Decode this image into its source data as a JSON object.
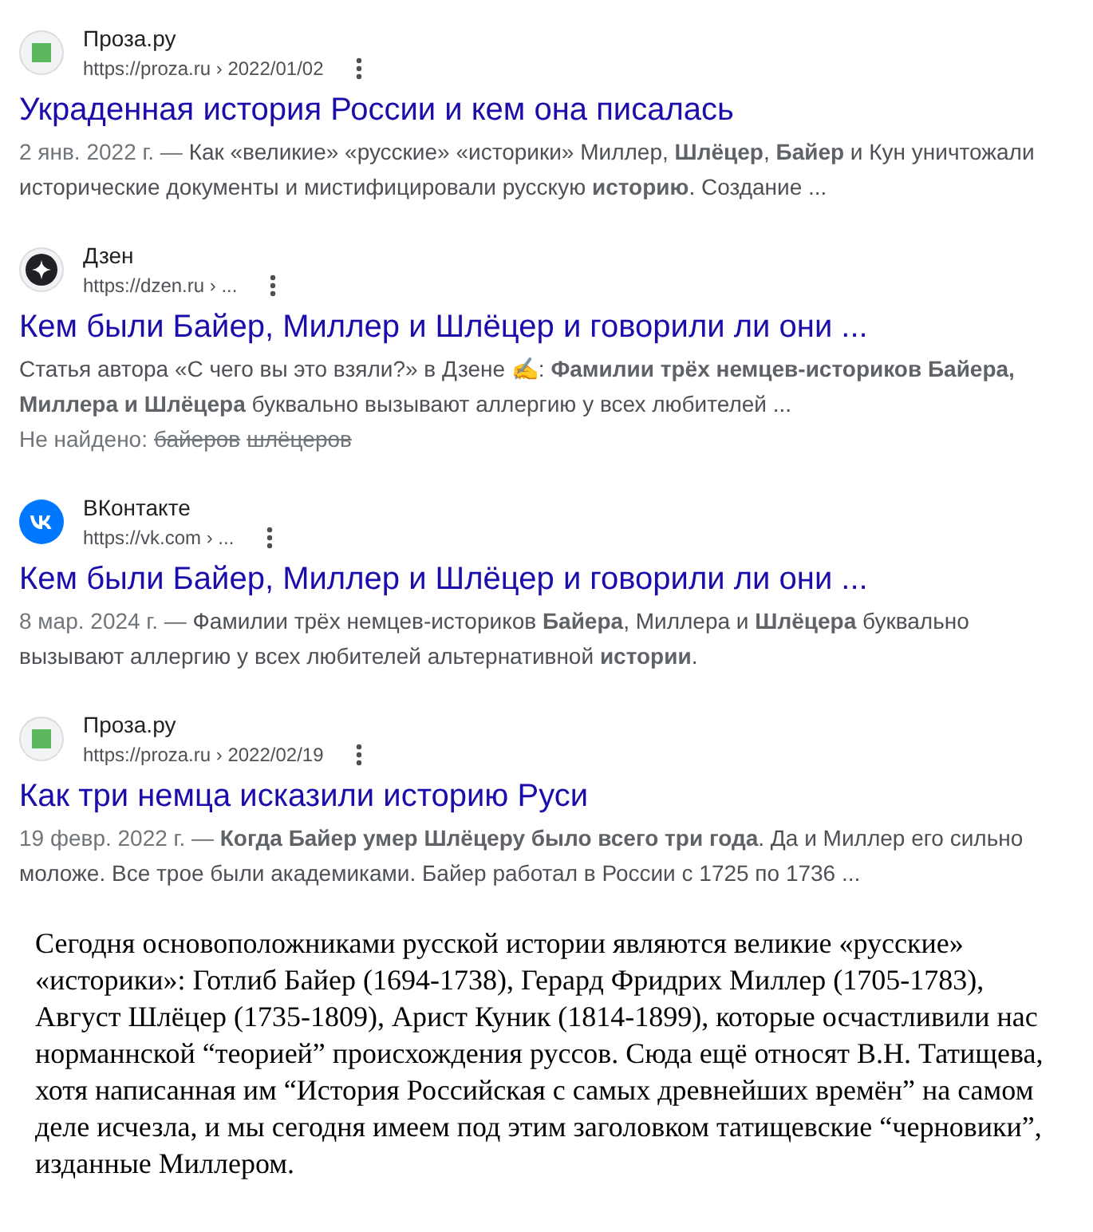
{
  "results": [
    {
      "kind": "proza",
      "site": "Проза.ру",
      "url": "https://proza.ru › 2022/01/02",
      "title": "Украденная история России и кем она писалась",
      "date": "2 янв. 2022 г. —",
      "snippet": "Как «великие» «русские» «историки» Миллер, **Шлёцер**, **Байер** и Кун уничтожали исторические документы и мистифицировали русскую **историю**. Создание ..."
    },
    {
      "kind": "dzen",
      "site": "Дзен",
      "url": "https://dzen.ru › ...",
      "title": "Кем были Байер, Миллер и Шлёцер и говорили ли они ...",
      "snippet": "Статья автора «С чего вы это взяли?» в Дзене ✍: **Фамилии трёх немцев-историков Байера, Миллера и Шлёцера** буквально вызывают аллергию у всех любителей ...",
      "not_found": {
        "label": "Не найдено:",
        "words": [
          "байеров",
          "шлёцеров"
        ]
      }
    },
    {
      "kind": "vk",
      "site": "ВКонтакте",
      "url": "https://vk.com › ...",
      "title": "Кем были Байер, Миллер и Шлёцер и говорили ли они ...",
      "date": "8 мар. 2024 г. —",
      "snippet": "Фамилии трёх немцев-историков **Байера**, Миллера и **Шлёцера** буквально вызывают аллергию у всех любителей альтернативной **истории**."
    },
    {
      "kind": "proza",
      "site": "Проза.ру",
      "url": "https://proza.ru › 2022/02/19",
      "title": "Как три немца исказили историю Руси",
      "date": "19 февр. 2022 г. —",
      "snippet": "**Когда Байер умер Шлёцеру было всего три года**. Да и Миллер его сильно моложе. Все трое были академиками. Байер работал в России с 1725 по 1736 ..."
    }
  ],
  "quote": "Сегодня основоположниками русской истории являются великие «русские» «историки»: Готлиб Байер (1694-1738), Герард Фридрих Миллер (1705-1783), Август Шлёцер (1735-1809), Арист Куник (1814-1899), которые осчастливили нас норманнской “теорией” происхождения руссов. Сюда ещё относят В.Н. Татищева, хотя написанная им “История Российская с самых древнейших времён” на самом деле исчезла, и мы сегодня имеем под этим заголовком татищевские “черновики”, изданные Миллером."
}
